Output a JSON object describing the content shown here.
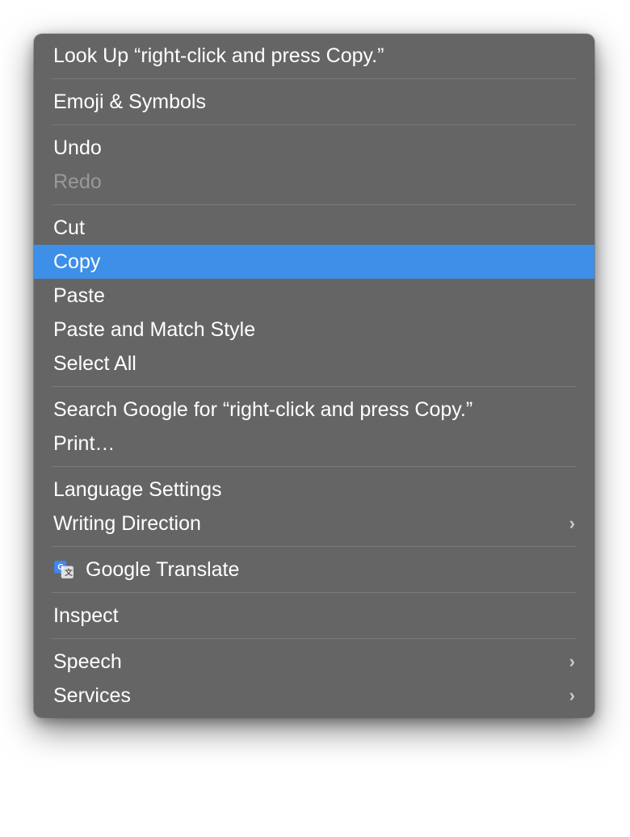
{
  "menu": {
    "groups": [
      [
        {
          "id": "lookup",
          "label": "Look Up “right-click and press Copy.”",
          "disabled": false,
          "highlighted": false,
          "submenu": false,
          "icon": null
        }
      ],
      [
        {
          "id": "emoji",
          "label": "Emoji & Symbols",
          "disabled": false,
          "highlighted": false,
          "submenu": false,
          "icon": null
        }
      ],
      [
        {
          "id": "undo",
          "label": "Undo",
          "disabled": false,
          "highlighted": false,
          "submenu": false,
          "icon": null
        },
        {
          "id": "redo",
          "label": "Redo",
          "disabled": true,
          "highlighted": false,
          "submenu": false,
          "icon": null
        }
      ],
      [
        {
          "id": "cut",
          "label": "Cut",
          "disabled": false,
          "highlighted": false,
          "submenu": false,
          "icon": null
        },
        {
          "id": "copy",
          "label": "Copy",
          "disabled": false,
          "highlighted": true,
          "submenu": false,
          "icon": null
        },
        {
          "id": "paste",
          "label": "Paste",
          "disabled": false,
          "highlighted": false,
          "submenu": false,
          "icon": null
        },
        {
          "id": "paste-match",
          "label": "Paste and Match Style",
          "disabled": false,
          "highlighted": false,
          "submenu": false,
          "icon": null
        },
        {
          "id": "select-all",
          "label": "Select All",
          "disabled": false,
          "highlighted": false,
          "submenu": false,
          "icon": null
        }
      ],
      [
        {
          "id": "search-google",
          "label": "Search Google for “right-click and press Copy.”",
          "disabled": false,
          "highlighted": false,
          "submenu": false,
          "icon": null
        },
        {
          "id": "print",
          "label": "Print…",
          "disabled": false,
          "highlighted": false,
          "submenu": false,
          "icon": null
        }
      ],
      [
        {
          "id": "language",
          "label": "Language Settings",
          "disabled": false,
          "highlighted": false,
          "submenu": false,
          "icon": null
        },
        {
          "id": "writing-direction",
          "label": "Writing Direction",
          "disabled": false,
          "highlighted": false,
          "submenu": true,
          "icon": null
        }
      ],
      [
        {
          "id": "google-translate",
          "label": "Google Translate",
          "disabled": false,
          "highlighted": false,
          "submenu": false,
          "icon": "translate"
        }
      ],
      [
        {
          "id": "inspect",
          "label": "Inspect",
          "disabled": false,
          "highlighted": false,
          "submenu": false,
          "icon": null
        }
      ],
      [
        {
          "id": "speech",
          "label": "Speech",
          "disabled": false,
          "highlighted": false,
          "submenu": true,
          "icon": null
        },
        {
          "id": "services",
          "label": "Services",
          "disabled": false,
          "highlighted": false,
          "submenu": true,
          "icon": null
        }
      ]
    ],
    "colors": {
      "background": "#656565",
      "highlight": "#3d8fe8",
      "text": "#ffffff",
      "disabled": "#999999",
      "divider": "#7a7a7a"
    }
  }
}
